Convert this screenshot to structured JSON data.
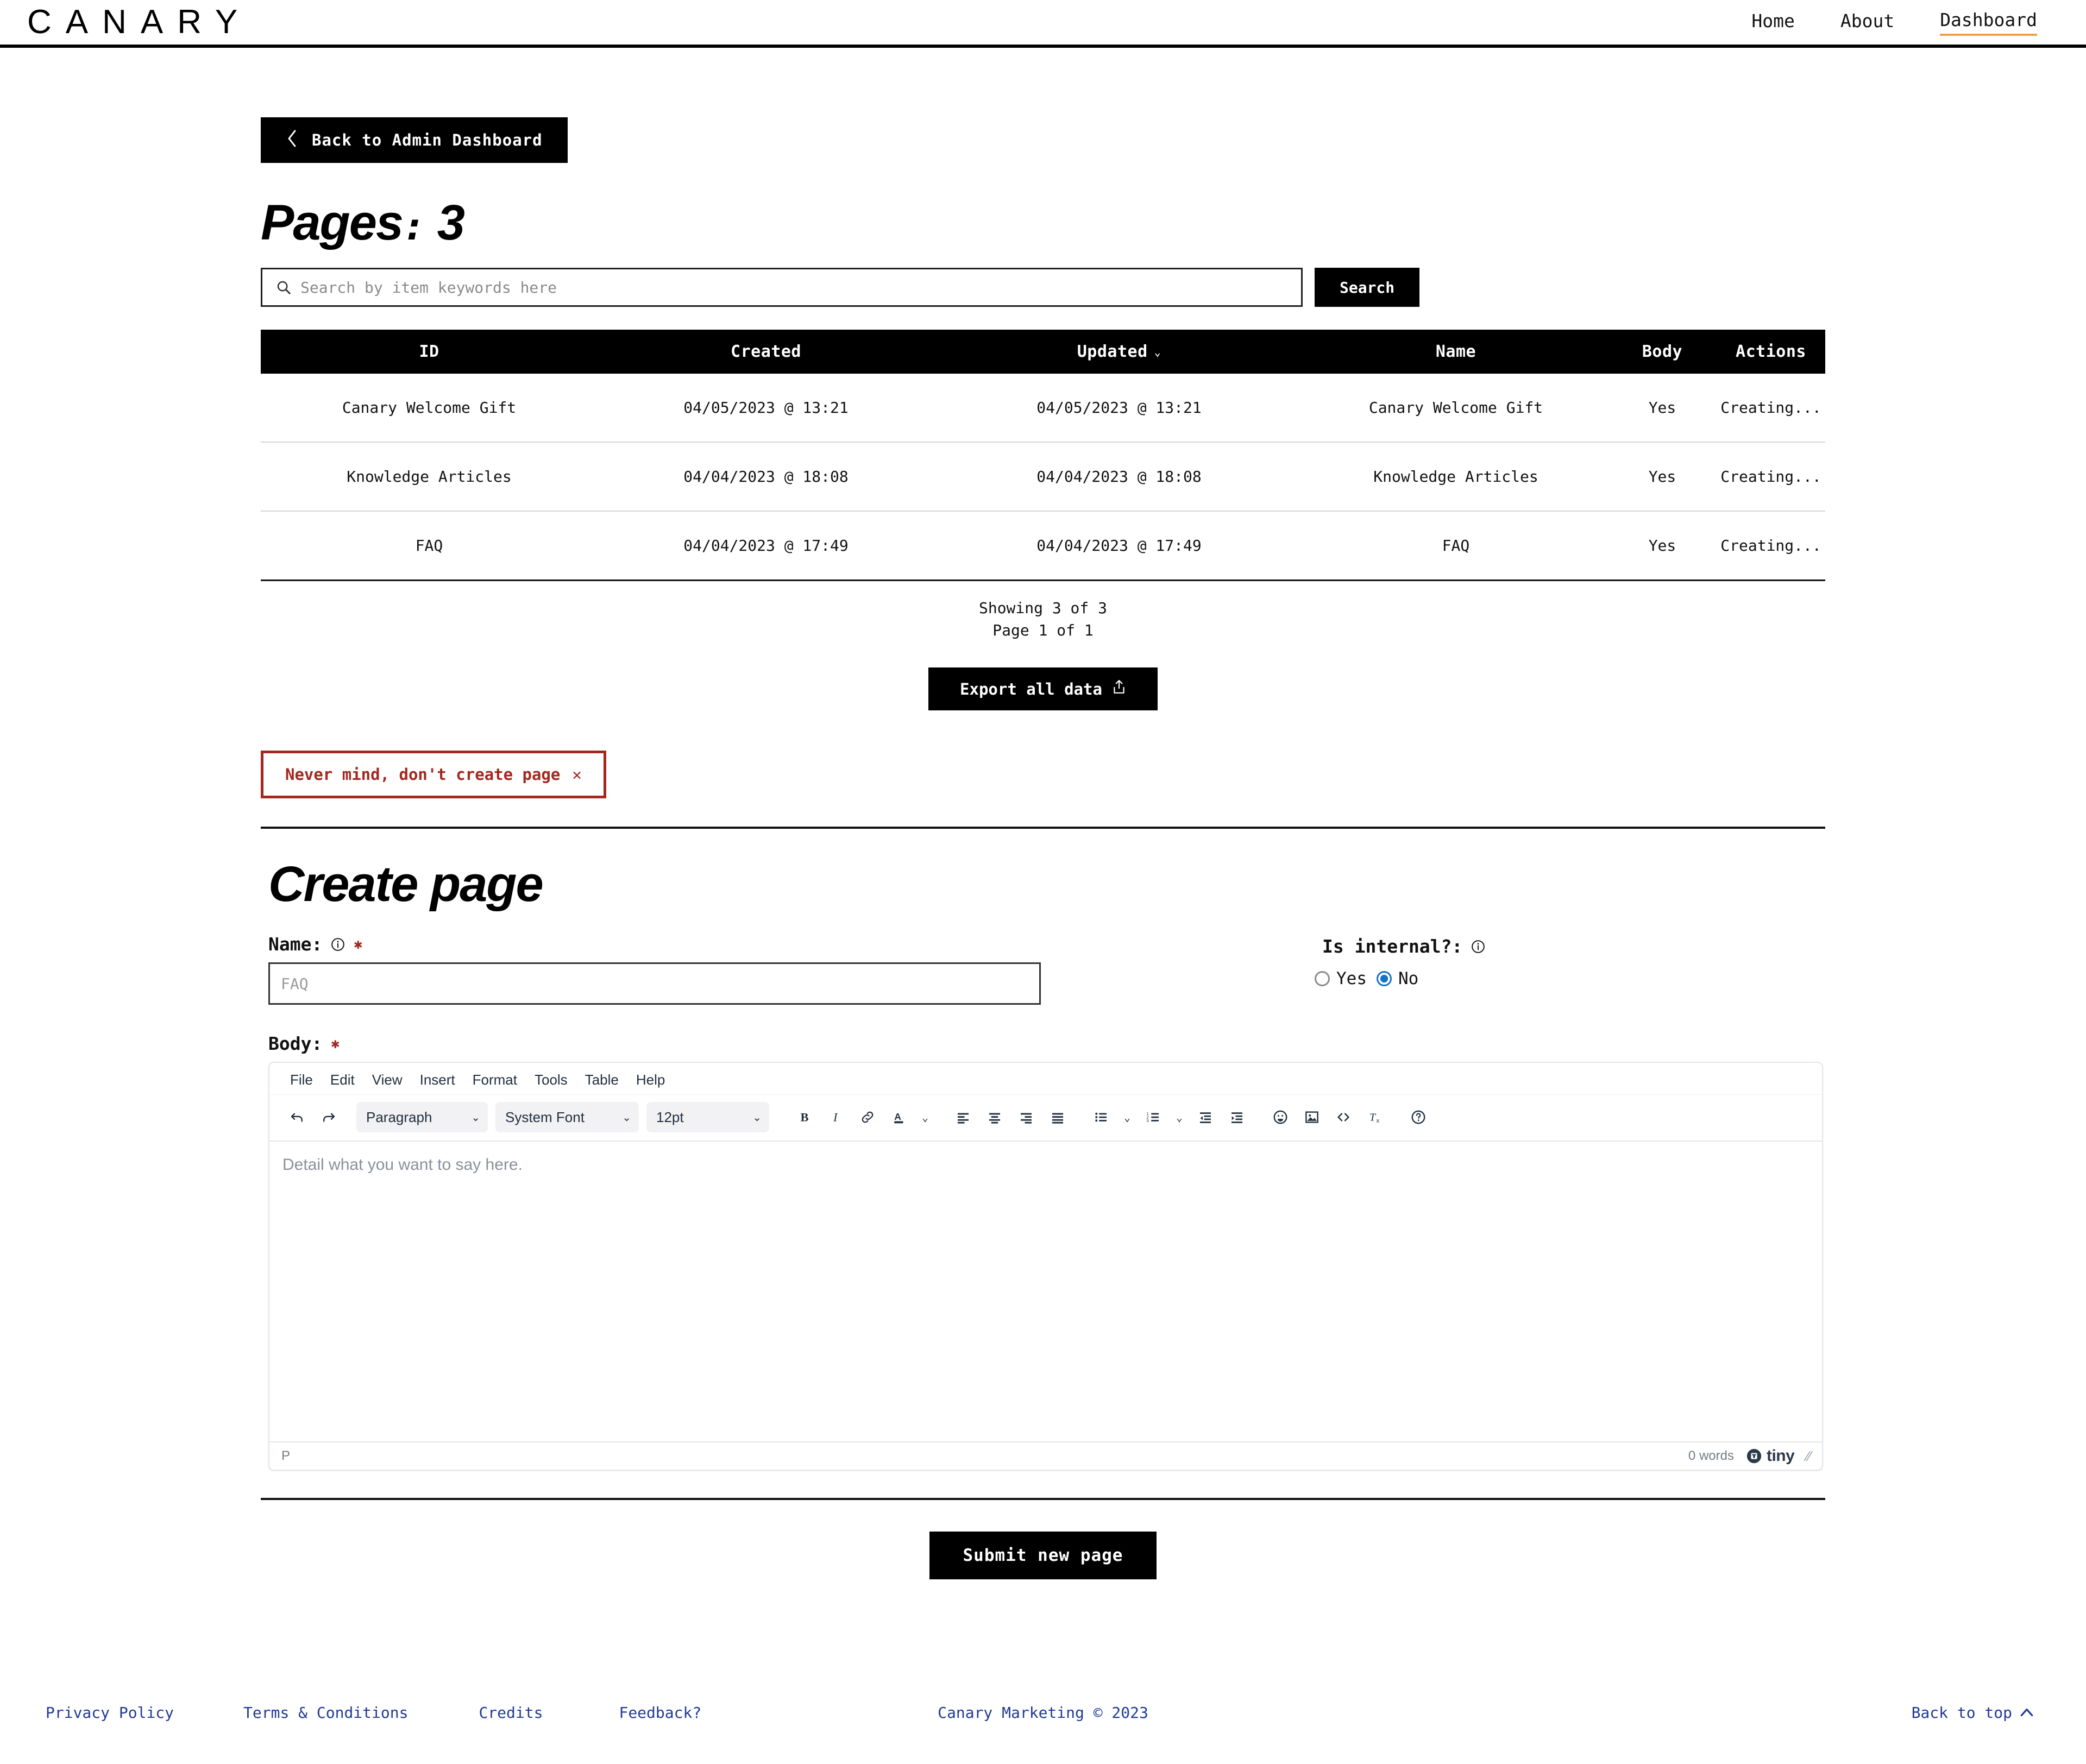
{
  "header": {
    "logo": "CANARY",
    "nav": [
      {
        "label": "Home",
        "active": false
      },
      {
        "label": "About",
        "active": false
      },
      {
        "label": "Dashboard",
        "active": true
      }
    ],
    "active_underline_color": "#f0a04b"
  },
  "toolbar": {
    "back_label": "Back to Admin Dashboard"
  },
  "page": {
    "title": "Pages",
    "title_sep": ":",
    "count": "3"
  },
  "search": {
    "placeholder": "Search by item keywords here",
    "value": "",
    "button_label": "Search",
    "icon": "search-icon"
  },
  "table": {
    "columns": [
      "ID",
      "Created",
      "Updated",
      "Name",
      "Body",
      "Actions"
    ],
    "sorted_column": "Updated",
    "sort_caret": "⌄",
    "rows": [
      {
        "id": "Canary Welcome Gift",
        "created": "04/05/2023 @ 13:21",
        "updated": "04/05/2023 @ 13:21",
        "name": "Canary Welcome Gift",
        "body": "Yes",
        "action": "Creating..."
      },
      {
        "id": "Knowledge Articles",
        "created": "04/04/2023 @ 18:08",
        "updated": "04/04/2023 @ 18:08",
        "name": "Knowledge Articles",
        "body": "Yes",
        "action": "Creating..."
      },
      {
        "id": "FAQ",
        "created": "04/04/2023 @ 17:49",
        "updated": "04/04/2023 @ 17:49",
        "name": "FAQ",
        "body": "Yes",
        "action": "Creating..."
      }
    ]
  },
  "pagination": {
    "showing": "Showing 3 of 3",
    "page": "Page 1 of 1"
  },
  "export": {
    "label": "Export all data",
    "icon": "upload-icon"
  },
  "cancel": {
    "label": "Never mind, don't create page",
    "close_glyph": "✕",
    "color": "#a3281f"
  },
  "form": {
    "heading": "Create page",
    "name_label": "Name:",
    "name_placeholder": "FAQ",
    "name_value": "",
    "required_glyph": "✱",
    "internal_label": "Is internal?:",
    "internal_options": [
      {
        "label": "Yes",
        "checked": false
      },
      {
        "label": "No",
        "checked": true
      }
    ],
    "internal_checked_color": "#1673c6",
    "body_label": "Body:",
    "submit_label": "Submit new page"
  },
  "editor": {
    "menubar": [
      "File",
      "Edit",
      "View",
      "Insert",
      "Format",
      "Tools",
      "Table",
      "Help"
    ],
    "selects": [
      {
        "name": "block-format",
        "value": "Paragraph"
      },
      {
        "name": "font-family",
        "value": "System Font"
      },
      {
        "name": "font-size",
        "value": "12pt"
      }
    ],
    "buttons": [
      "undo-icon",
      "redo-icon",
      "bold-icon",
      "italic-icon",
      "link-icon",
      "text-color-icon",
      "align-left-icon",
      "align-center-icon",
      "align-right-icon",
      "align-justify-icon",
      "bullet-list-icon",
      "numbered-list-icon",
      "outdent-icon",
      "indent-icon",
      "emoji-icon",
      "image-icon",
      "source-code-icon",
      "clear-formatting-icon",
      "help-icon"
    ],
    "placeholder": "Detail what you want to say here.",
    "status_path": "P",
    "word_count": "0 words",
    "brand": "tiny"
  },
  "footer": {
    "links": [
      "Privacy Policy",
      "Terms & Conditions",
      "Credits",
      "Feedback?"
    ],
    "copyright": "Canary Marketing © 2023",
    "back_to_top": "Back to top",
    "link_color": "#1f3a93"
  }
}
